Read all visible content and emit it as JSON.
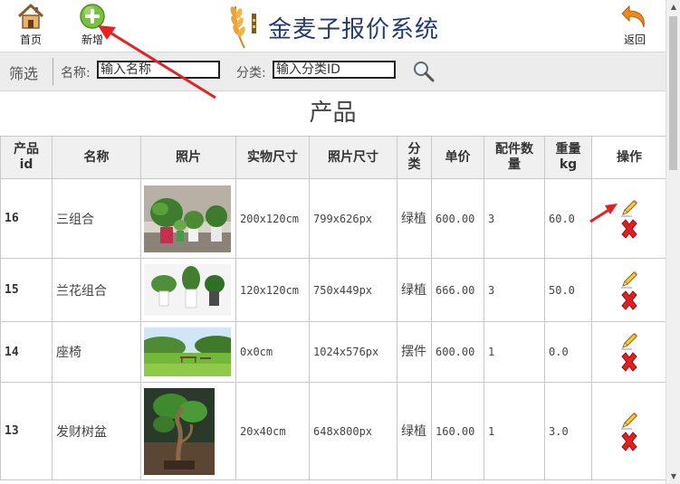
{
  "header": {
    "home_label": "首页",
    "add_label": "新增",
    "title": "金麦子报价系统",
    "back_label": "返回"
  },
  "filter": {
    "label": "筛选",
    "name_label": "名称:",
    "name_placeholder": "输入名称",
    "category_label": "分类:",
    "category_placeholder": "输入分类ID"
  },
  "section_title": "产品",
  "table": {
    "columns": [
      "产品id",
      "名称",
      "照片",
      "实物尺寸",
      "照片尺寸",
      "分类",
      "单价",
      "配件数量",
      "重量kg",
      "操作"
    ],
    "rows": [
      {
        "id": "16",
        "name": "三组合",
        "photo_icon": "potted-plants-photo",
        "real_size": "200x120cm",
        "photo_size": "799x626px",
        "category": "绿植",
        "price": "600.00",
        "parts": "3",
        "weight": "60.0"
      },
      {
        "id": "15",
        "name": "兰花组合",
        "photo_icon": "orchid-pots-photo",
        "real_size": "120x120cm",
        "photo_size": "750x449px",
        "category": "绿植",
        "price": "666.00",
        "parts": "3",
        "weight": "50.0"
      },
      {
        "id": "14",
        "name": "座椅",
        "photo_icon": "park-bench-photo",
        "real_size": "0x0cm",
        "photo_size": "1024x576px",
        "category": "摆件",
        "price": "600.00",
        "parts": "1",
        "weight": "0.0"
      },
      {
        "id": "13",
        "name": "发财树盆",
        "photo_icon": "bonsai-tree-photo",
        "real_size": "20x40cm",
        "photo_size": "648x800px",
        "category": "绿植",
        "price": "160.00",
        "parts": "1",
        "weight": "3.0"
      }
    ]
  },
  "colors": {
    "title": "#243a73",
    "annotation_arrow": "#e52121",
    "header_bg": "#f0f0f0",
    "filter_bg": "#ececec"
  }
}
